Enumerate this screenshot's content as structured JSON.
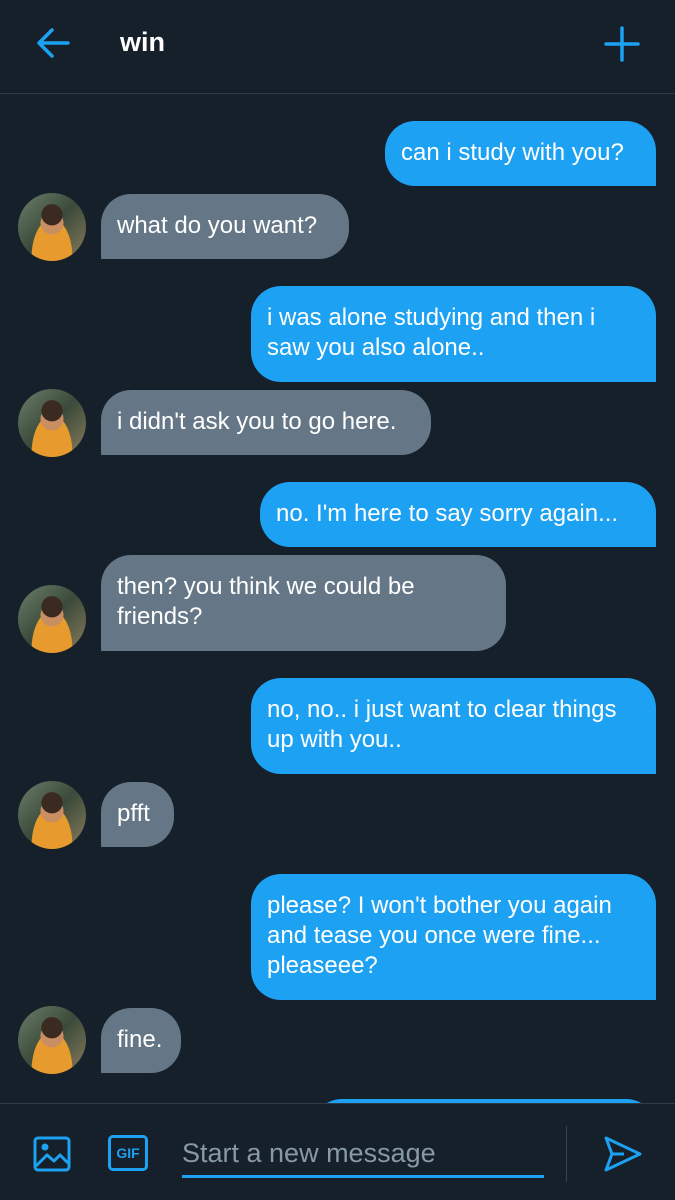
{
  "header": {
    "back_icon": "arrow-left-icon",
    "title": "win",
    "new_icon": "plus-icon"
  },
  "messages": [
    {
      "side": "sent",
      "text": "can i study with you?"
    },
    {
      "side": "received",
      "text": "what do you want?"
    },
    {
      "side": "sent",
      "text": "i was alone studying and then i saw you also alone.."
    },
    {
      "side": "received",
      "text": "i didn't ask you to go here."
    },
    {
      "side": "sent",
      "text": "no. I'm here to say sorry again..."
    },
    {
      "side": "received",
      "text": "then? you think we could be friends?"
    },
    {
      "side": "sent",
      "text": "no, no.. i just want to clear things up with you.."
    },
    {
      "side": "received",
      "text": "pfft"
    },
    {
      "side": "sent",
      "text": "please? I won't bother you again and tease you once were fine... pleaseee?"
    },
    {
      "side": "received",
      "text": "fine."
    }
  ],
  "composer": {
    "image_icon": "image-icon",
    "gif_label": "GIF",
    "placeholder": "Start a new message",
    "send_icon": "send-icon"
  },
  "colors": {
    "background": "#15202b",
    "sent_bubble": "#1da1f2",
    "received_bubble": "#657786",
    "accent": "#1da1f2"
  }
}
